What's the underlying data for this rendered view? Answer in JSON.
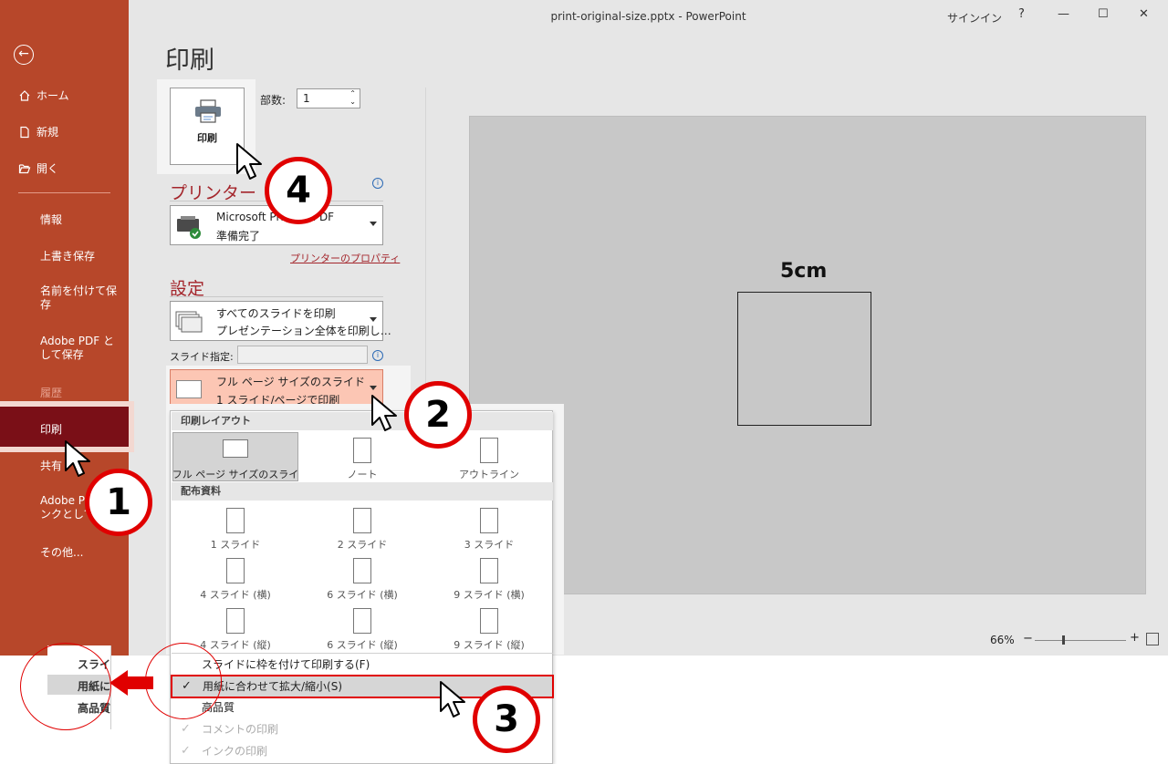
{
  "window": {
    "title": "print-original-size.pptx  -  PowerPoint",
    "signin": "サインイン",
    "help": "?",
    "minimize": "—",
    "maximize": "☐",
    "close": "✕"
  },
  "sidebar": {
    "items": [
      {
        "label": "ホーム",
        "icon": "home-icon"
      },
      {
        "label": "新規",
        "icon": "new-file-icon"
      },
      {
        "label": "開く",
        "icon": "folder-open-icon"
      },
      {
        "label": "情報"
      },
      {
        "label": "上書き保存"
      },
      {
        "label": "名前を付けて保存"
      },
      {
        "label": "Adobe PDF として保存"
      },
      {
        "label": "履歴"
      },
      {
        "label": "印刷"
      },
      {
        "label": "共有"
      },
      {
        "label": "Adobe PDF リンクとして共有"
      },
      {
        "label": "その他..."
      }
    ]
  },
  "print": {
    "page_title": "印刷",
    "print_button": "印刷",
    "copies_label": "部数:",
    "copies_value": "1",
    "printer_heading": "プリンター",
    "printer_name": "Microsoft Print to PDF",
    "printer_status": "準備完了",
    "printer_props": "プリンターのプロパティ",
    "settings_heading": "設定",
    "slides_line1": "すべてのスライドを印刷",
    "slides_line2": "プレゼンテーション全体を印刷し…",
    "slide_spec_label": "スライド指定:",
    "layout_line1": "フル ページ サイズのスライド",
    "layout_line2": "1 スライド/ページで印刷"
  },
  "menu": {
    "layout_header": "印刷レイアウト",
    "layout_items": [
      "フル ページ サイズのスライド",
      "ノート",
      "アウトライン"
    ],
    "handout_header": "配布資料",
    "handout_items": [
      "1 スライド",
      "2 スライド",
      "3 スライド",
      "4 スライド (横)",
      "6 スライド (横)",
      "9 スライド (横)",
      "4 スライド (縦)",
      "6 スライド (縦)",
      "9 スライド (縦)"
    ],
    "opt_frame": "スライドに枠を付けて印刷する(F)",
    "opt_scale": "用紙に合わせて拡大/縮小(S)",
    "opt_quality": "高品質",
    "opt_comments": "コメントの印刷",
    "opt_ink": "インクの印刷",
    "check": "✓"
  },
  "preview": {
    "label": "5cm",
    "zoom": "66%",
    "zoom_minus": "−",
    "zoom_plus": "+"
  },
  "zoom_inset": {
    "line1": "スライ",
    "line2": "用紙に",
    "line3": "高品質"
  },
  "callouts": [
    "1",
    "2",
    "3",
    "4"
  ],
  "colors": {
    "sidebar": "#b7472a",
    "selected": "#7a0f17",
    "accent": "#a4262c",
    "highlight": "#fcc6b4",
    "callout": "#e00000"
  }
}
